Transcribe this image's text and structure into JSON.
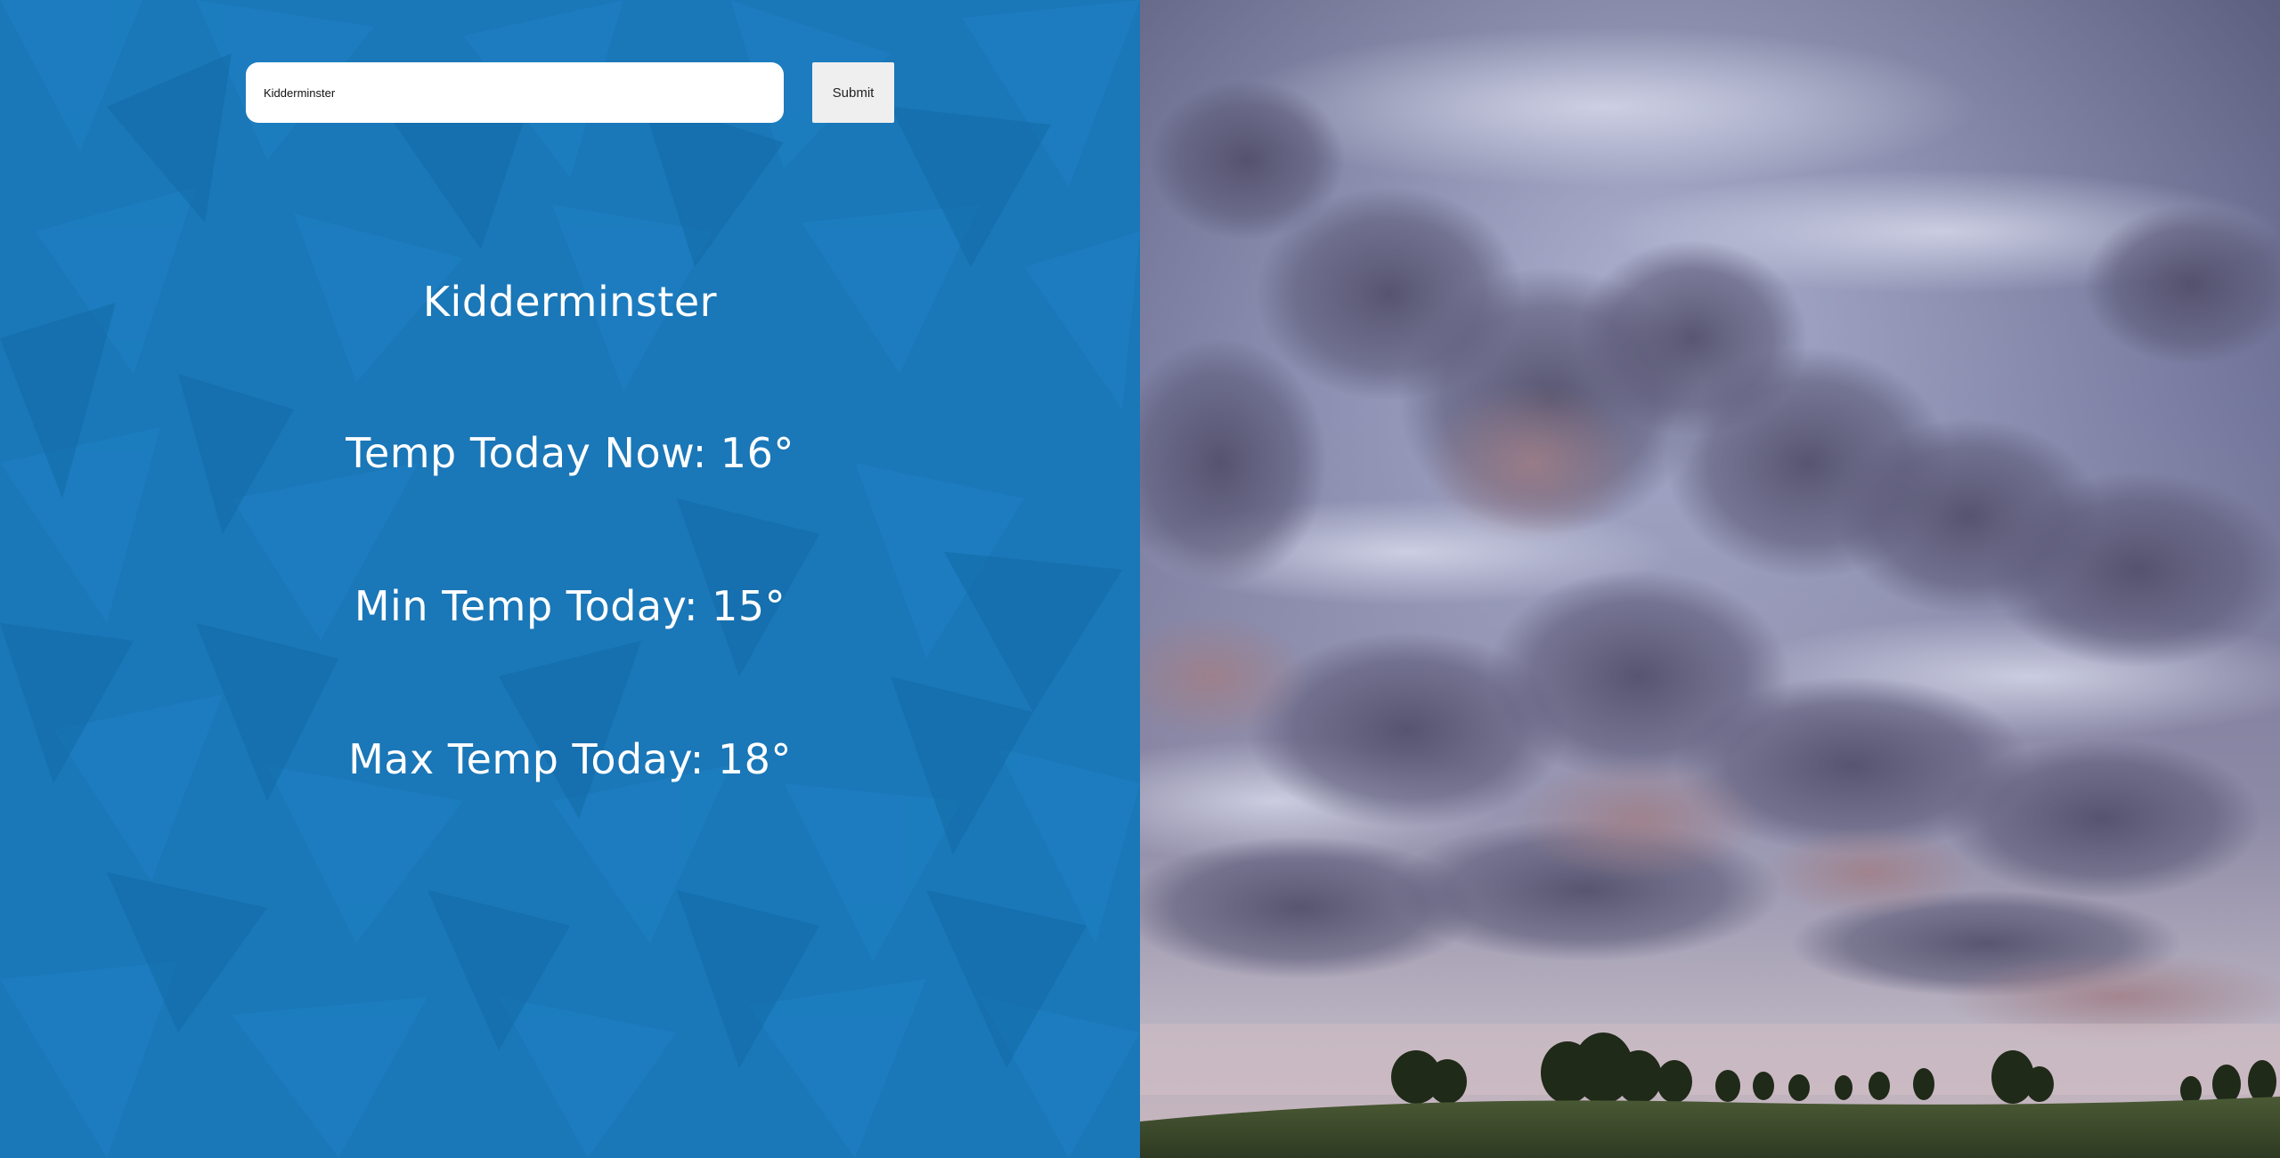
{
  "search": {
    "value": "Kidderminster",
    "submit_label": "Submit"
  },
  "weather": {
    "city": "Kidderminster",
    "temp_now_text": "Temp Today Now: 16°",
    "temp_min_text": "Min Temp Today: 15°",
    "temp_max_text": "Max Temp Today: 18°"
  },
  "colors": {
    "panel_background": "#1a77b8",
    "submit_background": "#efefef"
  },
  "image": {
    "icon": "storm-clouds-photo"
  }
}
